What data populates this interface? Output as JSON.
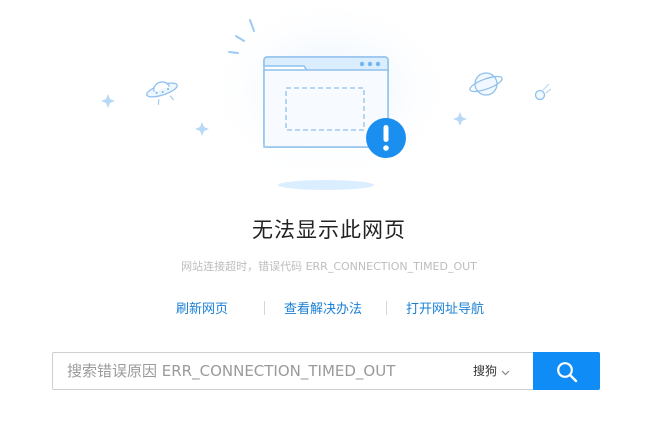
{
  "error": {
    "title": "无法显示此网页",
    "subtitle": "网站连接超时，错误代码 ERR_CONNECTION_TIMED_OUT"
  },
  "actions": {
    "refresh": "刷新网页",
    "solutions": "查看解决办法",
    "navigation": "打开网址导航"
  },
  "search": {
    "placeholder": "搜索错误原因 ERR_CONNECTION_TIMED_OUT",
    "value": "",
    "engine": "搜狗"
  },
  "colors": {
    "accent": "#0f8cf5",
    "link": "#1a7fd6",
    "illustration_light": "#dbeeff",
    "illustration_line": "#74b5ee"
  },
  "icons": {
    "window": "browser-window-icon",
    "alert": "exclamation-alert-icon",
    "ufo": "ufo-icon",
    "planet": "planet-icon",
    "comet": "comet-icon",
    "sparkle": "sparkle-icon",
    "search": "search-icon",
    "chevron": "chevron-down-icon"
  }
}
